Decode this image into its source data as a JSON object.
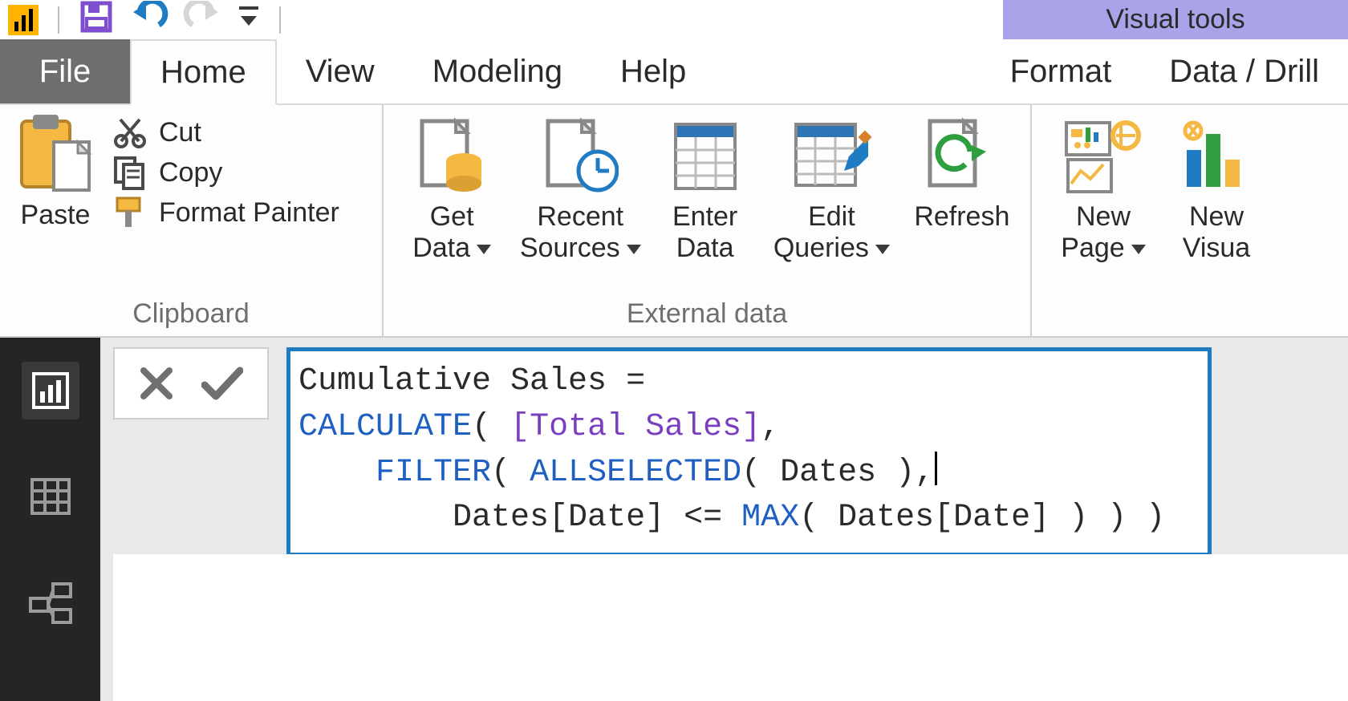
{
  "qat": {
    "app_icon": "powerbi-app-icon"
  },
  "visual_tools": {
    "label": "Visual tools"
  },
  "tabs": {
    "file": "File",
    "home": "Home",
    "view": "View",
    "modeling": "Modeling",
    "help": "Help",
    "format": "Format",
    "datadrill": "Data / Drill"
  },
  "ribbon": {
    "clipboard": {
      "group_label": "Clipboard",
      "paste": "Paste",
      "cut": "Cut",
      "copy": "Copy",
      "format_painter": "Format Painter"
    },
    "external_data": {
      "group_label": "External data",
      "get_data_1": "Get",
      "get_data_2": "Data",
      "recent_sources_1": "Recent",
      "recent_sources_2": "Sources",
      "enter_data_1": "Enter",
      "enter_data_2": "Data",
      "edit_queries_1": "Edit",
      "edit_queries_2": "Queries",
      "refresh": "Refresh"
    },
    "insert": {
      "new_page_1": "New",
      "new_page_2": "Page",
      "new_visual_1": "New",
      "new_visual_2": "Visua"
    }
  },
  "formula": {
    "line1_plain": "Cumulative Sales = ",
    "line2_func": "CALCULATE",
    "line2_openparen": "( ",
    "line2_measure": "[Total Sales]",
    "line2_comma": ",",
    "line3_indent": "    ",
    "line3_filter": "FILTER",
    "line3_open": "( ",
    "line3_allsel": "ALLSELECTED",
    "line3_dates": "( Dates ),",
    "line4_indent": "        ",
    "line4_a": "Dates[Date] <= ",
    "line4_max": "MAX",
    "line4_b": "( Dates[Date] ) ) )"
  }
}
